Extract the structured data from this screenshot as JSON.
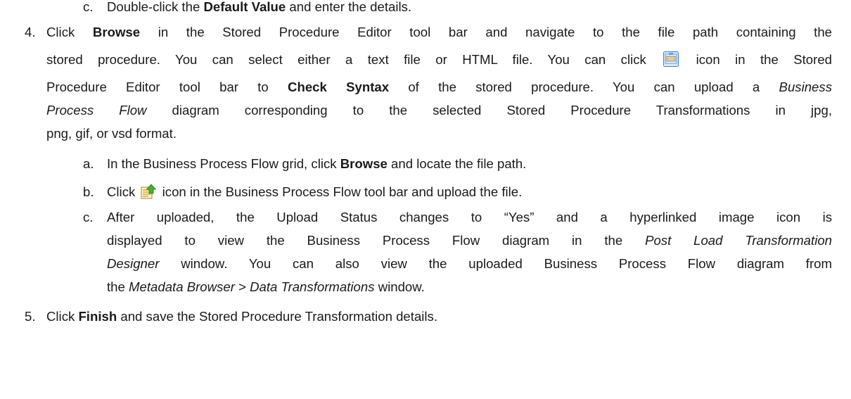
{
  "step3c": {
    "marker": "c.",
    "pre": "Double-click the ",
    "bold": "Default Value",
    "post": " and enter the details."
  },
  "step4": {
    "marker": "4.",
    "l1_a": "Click ",
    "l1_b": "Browse",
    "l1_c": " in the Stored Procedure Editor tool bar and navigate to the file path containing the",
    "l2_a": "stored procedure. You can select either a text file or HTML file. You can click",
    "l2_b": "icon in the Stored",
    "l3_a": "Procedure Editor tool bar to ",
    "l3_b": "Check Syntax",
    "l3_c": " of the stored procedure. You can upload a ",
    "l3_d": "Business",
    "l4_a": "Process Flow",
    "l4_b": " diagram corresponding to the selected Stored Procedure Transformations in jpg,",
    "l5": "png, gif, or vsd format.",
    "icon": "check-syntax-icon"
  },
  "step4a": {
    "marker": "a.",
    "pre": "In the Business Process Flow grid, click ",
    "bold": "Browse",
    "post": " and locate the file path."
  },
  "step4b": {
    "marker": "b.",
    "pre": "Click",
    "post": "icon in the Business Process Flow tool bar and upload the file.",
    "icon": "upload-icon"
  },
  "step4c": {
    "marker": "c.",
    "l1": "After uploaded, the Upload Status changes to “Yes” and a hyperlinked image icon is",
    "l2_a": "displayed to view the Business Process Flow diagram in the ",
    "l2_b": "Post Load Transformation",
    "l3_a": "Designer",
    "l3_b": " window. You can also view the uploaded Business Process Flow diagram from",
    "l4_a": "the ",
    "l4_b": "Metadata Browser",
    "l4_c": " > ",
    "l4_d": "Data Transformations",
    "l4_e": " window."
  },
  "step5": {
    "marker": "5.",
    "pre": "Click ",
    "bold": "Finish",
    "post": " and save the Stored Procedure Transformation details."
  }
}
